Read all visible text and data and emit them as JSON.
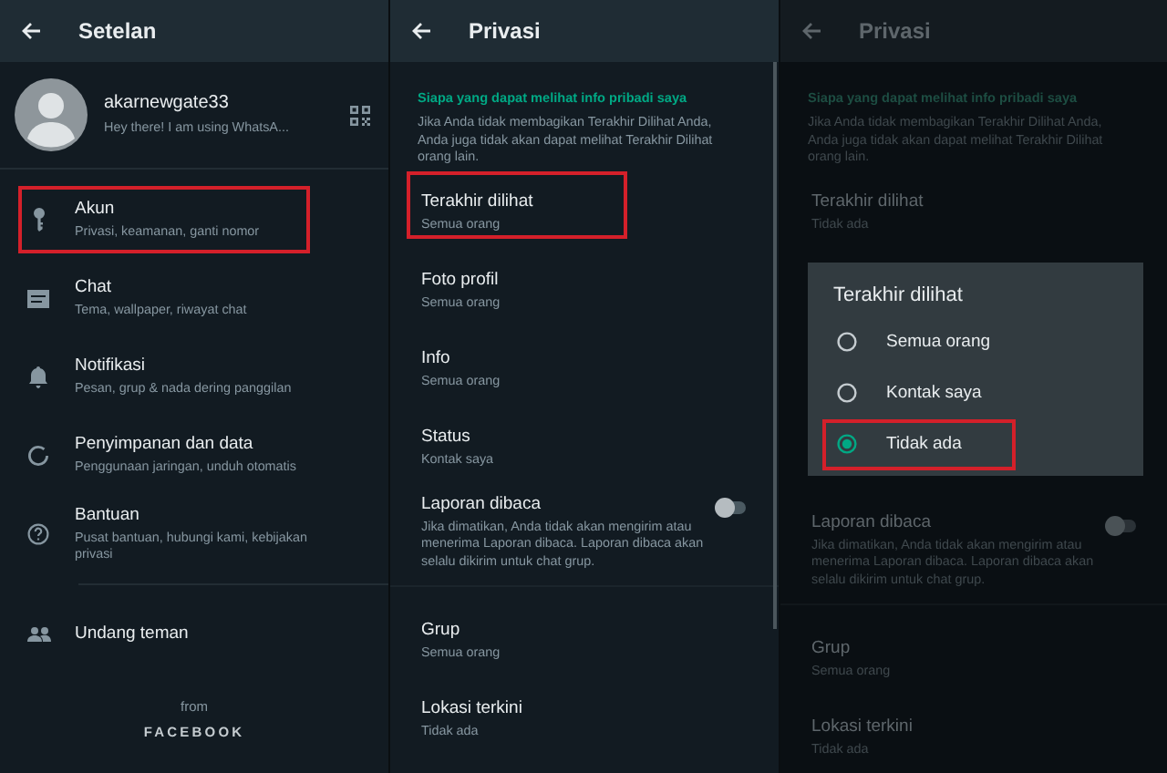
{
  "settings": {
    "title": "Setelan",
    "profile": {
      "name": "akarnewgate33",
      "status": "Hey there! I am using WhatsA..."
    },
    "items": [
      {
        "title": "Akun",
        "subtitle": "Privasi, keamanan, ganti nomor",
        "highlighted": true
      },
      {
        "title": "Chat",
        "subtitle": "Tema, wallpaper, riwayat chat",
        "highlighted": false
      },
      {
        "title": "Notifikasi",
        "subtitle": "Pesan, grup & nada dering panggilan",
        "highlighted": false
      },
      {
        "title": "Penyimpanan dan data",
        "subtitle": "Penggunaan jaringan, unduh otomatis",
        "highlighted": false
      },
      {
        "title": "Bantuan",
        "subtitle": "Pusat bantuan, hubungi kami, kebijakan privasi",
        "highlighted": false
      }
    ],
    "invite": "Undang teman",
    "footer": {
      "from": "from",
      "brand": "FACEBOOK"
    }
  },
  "privacy": {
    "title": "Privasi",
    "dimmed": false,
    "section_heading": "Siapa yang dapat melihat info pribadi saya",
    "section_note": "Jika Anda tidak membagikan Terakhir Dilihat Anda, Anda juga tidak akan dapat melihat Terakhir Dilihat orang lain.",
    "items_top": [
      {
        "title": "Terakhir dilihat",
        "subtitle": "Semua orang",
        "highlighted": true
      },
      {
        "title": "Foto profil",
        "subtitle": "Semua orang",
        "highlighted": false
      },
      {
        "title": "Info",
        "subtitle": "Semua orang",
        "highlighted": false
      },
      {
        "title": "Status",
        "subtitle": "Kontak saya",
        "highlighted": false
      },
      {
        "title": "Laporan dibaca",
        "subtitle": "Jika dimatikan, Anda tidak akan mengirim atau menerima Laporan dibaca. Laporan dibaca akan selalu dikirim untuk chat grup.",
        "on": false,
        "highlighted": false
      }
    ],
    "items_bottom": [
      {
        "title": "Grup",
        "subtitle": "Semua orang",
        "highlighted": false
      },
      {
        "title": "Lokasi terkini",
        "subtitle": "Tidak ada",
        "highlighted": false
      }
    ]
  },
  "privacy_dialog_view": {
    "title": "Privasi",
    "dimmed": true,
    "section_heading": "Siapa yang dapat melihat info pribadi saya",
    "section_note": "Jika Anda tidak membagikan Terakhir Dilihat Anda, Anda juga tidak akan dapat melihat Terakhir Dilihat orang lain.",
    "items_before": [
      {
        "title": "Terakhir dilihat",
        "subtitle": "Tidak ada",
        "highlighted": false
      }
    ],
    "dialog": {
      "title": "Terakhir dilihat",
      "options": [
        {
          "label": "Semua orang",
          "selected": false,
          "highlighted": false
        },
        {
          "label": "Kontak saya",
          "selected": false,
          "highlighted": false
        },
        {
          "label": "Tidak ada",
          "selected": true,
          "highlighted": true
        }
      ]
    },
    "items_top": [
      {
        "title": "Laporan dibaca",
        "subtitle": "Jika dimatikan, Anda tidak akan mengirim atau menerima Laporan dibaca. Laporan dibaca akan selalu dikirim untuk chat grup.",
        "on": false,
        "highlighted": false
      }
    ],
    "items_bottom": [
      {
        "title": "Grup",
        "subtitle": "Semua orang",
        "highlighted": false
      },
      {
        "title": "Lokasi terkini",
        "subtitle": "Tidak ada",
        "highlighted": false
      }
    ]
  }
}
